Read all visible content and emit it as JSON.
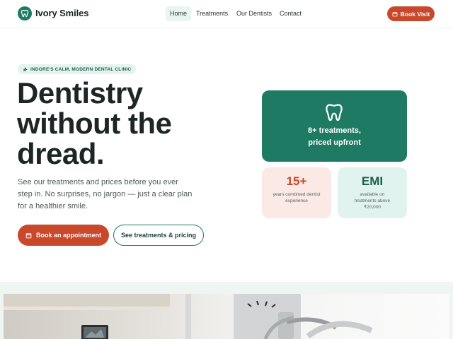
{
  "brand": {
    "name": "Ivory Smiles",
    "logo_icon": "tooth-icon"
  },
  "nav": {
    "links": [
      "Home",
      "Treatments",
      "Our Dentists",
      "Contact"
    ],
    "active": "Home",
    "cta_label": "Book Visit"
  },
  "hero": {
    "badge": "INDORE'S CALM, MODERN DENTAL CLINIC",
    "headline": [
      "Dentistry",
      "without the",
      "dread."
    ],
    "subtext": "See our treatments and prices before you ever step in. No surprises, no jargon — just a clear plan for a healthier smile.",
    "primary_button": "Book an appointment",
    "secondary_button": "See treatments & pricing"
  },
  "cards": {
    "main": {
      "icon": "tooth-icon",
      "lines": [
        "8+ treatments,",
        "priced upfront"
      ]
    },
    "experience": {
      "value": "15+",
      "caption": [
        "years combined dentist",
        "experience"
      ]
    },
    "emi": {
      "value": "EMI",
      "caption": [
        "available on",
        "treatments above",
        "₹20,000"
      ]
    }
  },
  "colors": {
    "brand_green": "#1e7a63",
    "accent_orange": "#c9482b",
    "pink_card": "#fae9e4",
    "mint_card": "#e1f3ee"
  }
}
